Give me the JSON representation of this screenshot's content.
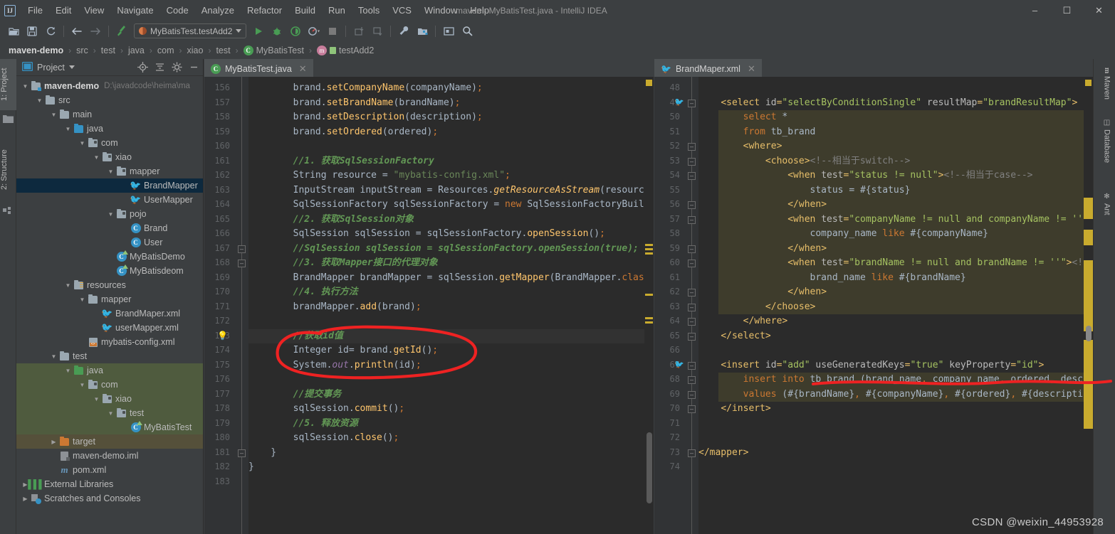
{
  "window": {
    "title": "maven - MyBatisTest.java - IntelliJ IDEA",
    "logo": "IJ",
    "minimize": "–",
    "maximize": "☐",
    "close": "✕"
  },
  "menubar": {
    "items": [
      {
        "label": "File"
      },
      {
        "label": "Edit"
      },
      {
        "label": "View"
      },
      {
        "label": "Navigate"
      },
      {
        "label": "Code"
      },
      {
        "label": "Analyze"
      },
      {
        "label": "Refactor"
      },
      {
        "label": "Build"
      },
      {
        "label": "Run"
      },
      {
        "label": "Tools"
      },
      {
        "label": "VCS"
      },
      {
        "label": "Window"
      },
      {
        "label": "Help"
      }
    ]
  },
  "toolbar": {
    "open_icon": "open-folder-icon",
    "save_icon": "save-icon",
    "sync_icon": "sync-icon",
    "back_icon": "back-arrow-icon",
    "forward_icon": "forward-arrow-icon",
    "build_icon": "build-hammer-icon",
    "run_config_label": "MyBatisTest.testAdd2",
    "run_icon": "run-icon",
    "debug_icon": "debug-icon",
    "coverage_icon": "run-coverage-icon",
    "profile_icon": "profile-icon",
    "stop_icon": "stop-icon",
    "update_icon": "update-project-icon",
    "commit_icon": "commit-icon",
    "settings_icon": "settings-wrench-icon",
    "structure_icon": "project-structure-icon",
    "terminal_icon": "terminal-icon",
    "search_icon": "search-everywhere-icon"
  },
  "breadcrumb": {
    "items": [
      {
        "label": "maven-demo",
        "icon": "project-icon",
        "bold": true
      },
      {
        "label": "src",
        "icon": ""
      },
      {
        "label": "test",
        "icon": ""
      },
      {
        "label": "java",
        "icon": ""
      },
      {
        "label": "com",
        "icon": ""
      },
      {
        "label": "xiao",
        "icon": ""
      },
      {
        "label": "test",
        "icon": ""
      },
      {
        "label": "MyBatisTest",
        "icon": "class-icon"
      },
      {
        "label": "testAdd2",
        "icon": "method-icon"
      }
    ],
    "separator": "›"
  },
  "left_toolwindows": [
    {
      "label": "1: Project",
      "selected": true
    },
    {
      "label": "2: Structure",
      "selected": false
    }
  ],
  "right_toolwindows": [
    {
      "label": "Maven",
      "icon": "maven-icon"
    },
    {
      "label": "Database",
      "icon": "database-icon"
    },
    {
      "label": "Ant",
      "icon": "ant-icon"
    }
  ],
  "project_panel": {
    "title": "Project",
    "dropdown_icon": "chevron-down-icon",
    "locate_icon": "locate-target-icon",
    "collapse_icon": "collapse-all-icon",
    "settings_icon": "gear-icon",
    "hide_icon": "hide-panel-icon",
    "tree": [
      {
        "label": "maven-demo",
        "hint": "D:\\javadcode\\heima\\ma",
        "depth": 0,
        "arrow": "▼",
        "icon": "project-folder-icon",
        "state": "root"
      },
      {
        "label": "src",
        "hint": "",
        "depth": 1,
        "arrow": "▼",
        "icon": "folder-grey-icon",
        "state": ""
      },
      {
        "label": "main",
        "hint": "",
        "depth": 2,
        "arrow": "▼",
        "icon": "folder-grey-icon",
        "state": ""
      },
      {
        "label": "java",
        "hint": "",
        "depth": 3,
        "arrow": "▼",
        "icon": "folder-blue-icon",
        "state": ""
      },
      {
        "label": "com",
        "hint": "",
        "depth": 4,
        "arrow": "▼",
        "icon": "package-icon",
        "state": ""
      },
      {
        "label": "xiao",
        "hint": "",
        "depth": 5,
        "arrow": "▼",
        "icon": "package-icon",
        "state": ""
      },
      {
        "label": "mapper",
        "hint": "",
        "depth": 6,
        "arrow": "▼",
        "icon": "package-icon",
        "state": ""
      },
      {
        "label": "BrandMapper",
        "hint": "",
        "depth": 7,
        "arrow": "",
        "icon": "mybatis-mapper-icon",
        "state": "selected"
      },
      {
        "label": "UserMapper",
        "hint": "",
        "depth": 7,
        "arrow": "",
        "icon": "mybatis-mapper-icon",
        "state": ""
      },
      {
        "label": "pojo",
        "hint": "",
        "depth": 6,
        "arrow": "▼",
        "icon": "package-icon",
        "state": ""
      },
      {
        "label": "Brand",
        "hint": "",
        "depth": 7,
        "arrow": "",
        "icon": "class-icon",
        "state": ""
      },
      {
        "label": "User",
        "hint": "",
        "depth": 7,
        "arrow": "",
        "icon": "class-icon",
        "state": ""
      },
      {
        "label": "MyBatisDemo",
        "hint": "",
        "depth": 6,
        "arrow": "",
        "icon": "runnable-class-icon",
        "state": ""
      },
      {
        "label": "MyBatisdeom",
        "hint": "",
        "depth": 6,
        "arrow": "",
        "icon": "runnable-class-icon",
        "state": ""
      },
      {
        "label": "resources",
        "hint": "",
        "depth": 3,
        "arrow": "▼",
        "icon": "resources-folder-icon",
        "state": ""
      },
      {
        "label": "mapper",
        "hint": "",
        "depth": 4,
        "arrow": "▼",
        "icon": "folder-grey-icon",
        "state": ""
      },
      {
        "label": "BrandMaper.xml",
        "hint": "",
        "depth": 5,
        "arrow": "",
        "icon": "mybatis-xml-icon",
        "state": ""
      },
      {
        "label": "userMapper.xml",
        "hint": "",
        "depth": 5,
        "arrow": "",
        "icon": "mybatis-xml-icon",
        "state": ""
      },
      {
        "label": "mybatis-config.xml",
        "hint": "",
        "depth": 4,
        "arrow": "",
        "icon": "xml-file-icon",
        "state": ""
      },
      {
        "label": "test",
        "hint": "",
        "depth": 2,
        "arrow": "▼",
        "icon": "folder-grey-icon",
        "state": ""
      },
      {
        "label": "java",
        "hint": "",
        "depth": 3,
        "arrow": "▼",
        "icon": "folder-green-icon",
        "state": "green"
      },
      {
        "label": "com",
        "hint": "",
        "depth": 4,
        "arrow": "▼",
        "icon": "package-icon",
        "state": "green"
      },
      {
        "label": "xiao",
        "hint": "",
        "depth": 5,
        "arrow": "▼",
        "icon": "package-icon",
        "state": "green"
      },
      {
        "label": "test",
        "hint": "",
        "depth": 6,
        "arrow": "▼",
        "icon": "package-icon",
        "state": "green"
      },
      {
        "label": "MyBatisTest",
        "hint": "",
        "depth": 7,
        "arrow": "",
        "icon": "runnable-class-icon",
        "state": "green"
      },
      {
        "label": "target",
        "hint": "",
        "depth": 2,
        "arrow": "▶",
        "icon": "folder-orange-icon",
        "state": "brown"
      },
      {
        "label": "maven-demo.iml",
        "hint": "",
        "depth": 2,
        "arrow": "",
        "icon": "iml-file-icon",
        "state": ""
      },
      {
        "label": "pom.xml",
        "hint": "",
        "depth": 2,
        "arrow": "",
        "icon": "maven-pom-icon",
        "state": ""
      },
      {
        "label": "External Libraries",
        "hint": "",
        "depth": 0,
        "arrow": "▶",
        "icon": "libraries-icon",
        "state": ""
      },
      {
        "label": "Scratches and Consoles",
        "hint": "",
        "depth": 0,
        "arrow": "▶",
        "icon": "scratches-icon",
        "state": ""
      }
    ]
  },
  "editor_java": {
    "tab_label": "MyBatisTest.java",
    "tab_icon": "java-runnable-class-icon",
    "close_icon": "close-icon",
    "first_line": 156,
    "lines": [
      {
        "n": 156,
        "html": "        brand.<m>setCompanyName</m>(companyName)<p>;</p>"
      },
      {
        "n": 157,
        "html": "        brand.<m>setBrandName</m>(brandName)<p>;</p>"
      },
      {
        "n": 158,
        "html": "        brand.<m>setDescription</m>(description)<p>;</p>"
      },
      {
        "n": 159,
        "html": "        brand.<m>setOrdered</m>(ordered)<p>;</p>"
      },
      {
        "n": 160,
        "html": ""
      },
      {
        "n": 161,
        "html": "        <c>//1. 获取SqlSessionFactory</c>"
      },
      {
        "n": 162,
        "html": "        String resource = <s>\"mybatis-config.xml\"</s><p>;</p>"
      },
      {
        "n": 163,
        "html": "        InputStream inputStream = Resources.<mi>getResourceAsStream</mi>(resourc"
      },
      {
        "n": 164,
        "html": "        SqlSessionFactory sqlSessionFactory = <k>new</k> SqlSessionFactoryBuil"
      },
      {
        "n": 165,
        "html": "        <c>//2. 获取SqlSession对象</c>"
      },
      {
        "n": 166,
        "html": "        SqlSession sqlSession = sqlSessionFactory.<m>openSession</m>()<p>;</p>"
      },
      {
        "n": 167,
        "html": "        <c>//SqlSession sqlSession = sqlSessionFactory.openSession(true);</c>"
      },
      {
        "n": 168,
        "html": "        <c>//3. 获取Mapper接口的代理对象</c>"
      },
      {
        "n": 169,
        "html": "        BrandMapper brandMapper = sqlSession.<m>getMapper</m>(BrandMapper.<k>clas</k>"
      },
      {
        "n": 170,
        "html": "        <c>//4. 执行方法</c>"
      },
      {
        "n": 171,
        "html": "        brandMapper.<m>add</m>(brand)<p>;</p>"
      },
      {
        "n": 172,
        "html": ""
      },
      {
        "n": 173,
        "html": "        <c>//获取id值</c>"
      },
      {
        "n": 174,
        "html": "        Integer id= brand.<m>getId</m>()<p>;</p>"
      },
      {
        "n": 175,
        "html": "        System.<f>out</f>.<m>println</m>(id)<p>;</p>"
      },
      {
        "n": 176,
        "html": ""
      },
      {
        "n": 177,
        "html": "        <c>//提交事务</c>"
      },
      {
        "n": 178,
        "html": "        sqlSession.<m>commit</m>()<p>;</p>"
      },
      {
        "n": 179,
        "html": "        <c>//5. 释放资源</c>"
      },
      {
        "n": 180,
        "html": "        sqlSession.<m>close</m>()<p>;</p>"
      },
      {
        "n": 181,
        "html": "    }"
      },
      {
        "n": 182,
        "html": "}"
      },
      {
        "n": 183,
        "html": ""
      }
    ],
    "highlighted_line": 173,
    "bulb_icon": "intention-bulb-icon",
    "fold_lines": [
      167,
      168,
      181
    ]
  },
  "editor_xml": {
    "tab_label": "BrandMaper.xml",
    "tab_icon": "mybatis-xml-icon",
    "close_icon": "close-icon",
    "first_line": 48,
    "lines": [
      {
        "n": 48,
        "html": ""
      },
      {
        "n": 49,
        "html": "    <t>&lt;select</t> <a>id</a><t>=</t><v>\"selectByConditionSingle\"</v> <a>resultMap</a><t>=</t><v>\"brandResultMap\"</v><t>&gt;</t>"
      },
      {
        "n": 50,
        "html": "        <q>select</q> *"
      },
      {
        "n": 51,
        "html": "        <q>from</q> tb_brand"
      },
      {
        "n": 52,
        "html": "        <t>&lt;where&gt;</t>"
      },
      {
        "n": 53,
        "html": "            <t>&lt;choose&gt;</t><x>&lt;!--相当于switch--&gt;</x>"
      },
      {
        "n": 54,
        "html": "                <t>&lt;when</t> <a>test</a><t>=</t><v>\"status != null\"</v><t>&gt;</t><x>&lt;!--相当于case--&gt;</x>"
      },
      {
        "n": 55,
        "html": "                    status = #{status}"
      },
      {
        "n": 56,
        "html": "                <t>&lt;/when&gt;</t>"
      },
      {
        "n": 57,
        "html": "                <t>&lt;when</t> <a>test</a><t>=</t><v>\"companyName != null and companyName != ''</v>"
      },
      {
        "n": 58,
        "html": "                    company_name <q>like</q> #{companyName}"
      },
      {
        "n": 59,
        "html": "                <t>&lt;/when&gt;</t>"
      },
      {
        "n": 60,
        "html": "                <t>&lt;when</t> <a>test</a><t>=</t><v>\"brandName != null and brandName != ''\"</v><t>&gt;</t><x>&lt;!--</x>"
      },
      {
        "n": 61,
        "html": "                    brand_name <q>like</q> #{brandName}"
      },
      {
        "n": 62,
        "html": "                <t>&lt;/when&gt;</t>"
      },
      {
        "n": 63,
        "html": "            <t>&lt;/choose&gt;</t>"
      },
      {
        "n": 64,
        "html": "        <t>&lt;/where&gt;</t>"
      },
      {
        "n": 65,
        "html": "    <t>&lt;/select&gt;</t>"
      },
      {
        "n": 66,
        "html": ""
      },
      {
        "n": 67,
        "html": "    <t>&lt;insert</t> <a>id</a><t>=</t><v>\"add\"</v> <a>useGeneratedKeys</a><t>=</t><v>\"true\"</v> <a>keyProperty</a><t>=</t><v>\"id\"</v><t>&gt;</t>"
      },
      {
        "n": 68,
        "html": "        <q>insert into</q> tb_brand (brand_name<p>,</p> company_name<p>,</p> ordered<p>,</p> descripti"
      },
      {
        "n": 69,
        "html": "        <q>values</q> (#{brandName}<p>,</p> #{companyName}<p>,</p> #{ordered}<p>,</p> #{description}<p>,</p>"
      },
      {
        "n": 70,
        "html": "    <t>&lt;/insert&gt;</t>"
      },
      {
        "n": 71,
        "html": ""
      },
      {
        "n": 72,
        "html": ""
      },
      {
        "n": 73,
        "html": "<t>&lt;/mapper&gt;</t>"
      },
      {
        "n": 74,
        "html": ""
      }
    ],
    "statement_icon_lines": [
      49,
      67
    ]
  },
  "annotations": {
    "circle_label": "red-circle-annotation",
    "underline_label": "red-underline-annotation",
    "color": "#ee2222"
  },
  "watermark": "CSDN @weixin_44953928"
}
